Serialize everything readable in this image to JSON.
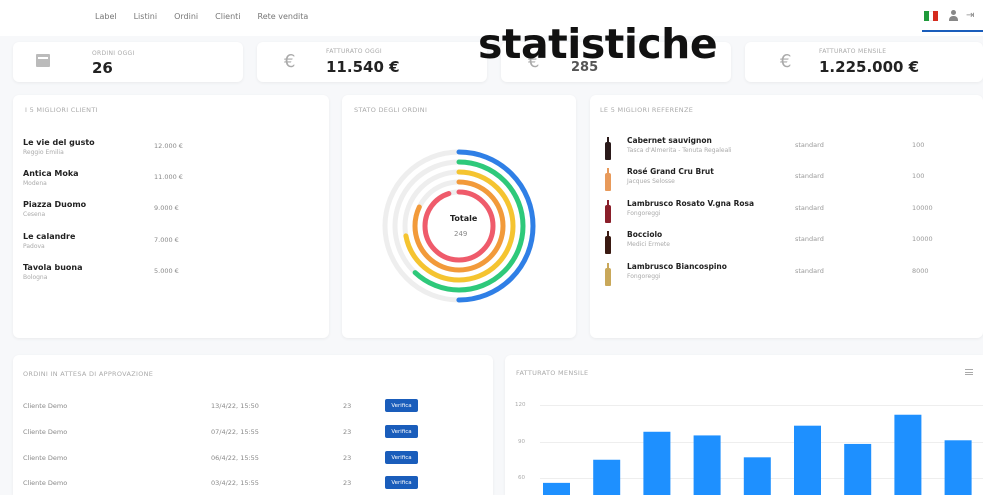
{
  "nav": [
    "Label",
    "Listini",
    "Ordini",
    "Clienti",
    "Rete vendita"
  ],
  "overlay_title": "statistiche",
  "colors": {
    "accent": "#1a5dbb",
    "bar": "#1e90ff",
    "flag": [
      "#1e9a3a",
      "#ffffff",
      "#d52b1e"
    ]
  },
  "kpis": [
    {
      "label": "ORDINI OGGI",
      "value": "26",
      "icon": "box-icon"
    },
    {
      "label": "FATTURATO OGGI",
      "value": "11.540 €",
      "icon": "euro-icon"
    },
    {
      "label": "",
      "value": "285",
      "icon": "euro-icon"
    },
    {
      "label": "FATTURATO MENSILE",
      "value": "1.225.000 €",
      "icon": "euro-icon"
    }
  ],
  "top_clients": {
    "title": "I 5 MIGLIORI CLIENTI",
    "items": [
      {
        "name": "Le vie del gusto",
        "city": "Reggio Emilia",
        "value": "12.000 €"
      },
      {
        "name": "Antica Moka",
        "city": "Modena",
        "value": "11.000 €"
      },
      {
        "name": "Piazza Duomo",
        "city": "Cesena",
        "value": "9.000 €"
      },
      {
        "name": "Le calandre",
        "city": "Padova",
        "value": "7.000 €"
      },
      {
        "name": "Tavola buona",
        "city": "Bologna",
        "value": "5.000 €"
      }
    ]
  },
  "order_status": {
    "title": "STATO DEGLI ORDINI",
    "center_label": "Totale",
    "center_value": "249",
    "rings": [
      {
        "color": "#2f7fe6",
        "fraction": 0.5
      },
      {
        "color": "#2ec97a",
        "fraction": 0.62
      },
      {
        "color": "#f5c430",
        "fraction": 0.72
      },
      {
        "color": "#f29a3a",
        "fraction": 0.82
      },
      {
        "color": "#ef5b6b",
        "fraction": 0.95
      }
    ]
  },
  "top_refs": {
    "title": "LE 5 MIGLIORI REFERENZE",
    "items": [
      {
        "name": "Cabernet sauvignon",
        "producer": "Tasca d'Almerita - Tenuta Regaleali",
        "type": "standard",
        "qty": "100",
        "bottle_color": "#2a1a1a"
      },
      {
        "name": "Rosé Grand Cru Brut",
        "producer": "Jacques Selosse",
        "type": "standard",
        "qty": "100",
        "bottle_color": "#e89a5a"
      },
      {
        "name": "Lambrusco Rosato V.gna Rosa",
        "producer": "Fongoreggi",
        "type": "standard",
        "qty": "10000",
        "bottle_color": "#8a1f2a"
      },
      {
        "name": "Bocciolo",
        "producer": "Medici Ermete",
        "type": "standard",
        "qty": "10000",
        "bottle_color": "#3a1a12"
      },
      {
        "name": "Lambrusco Biancospino",
        "producer": "Fongoreggi",
        "type": "standard",
        "qty": "8000",
        "bottle_color": "#c9a85a"
      }
    ]
  },
  "pending_orders": {
    "title": "ORDINI IN ATTESA DI APPROVAZIONE",
    "rows": [
      {
        "client": "Cliente Demo",
        "date": "13/4/22, 15:50",
        "qty": "23",
        "action": "Verifica"
      },
      {
        "client": "Cliente Demo",
        "date": "07/4/22, 15:55",
        "qty": "23",
        "action": "Verifica"
      },
      {
        "client": "Cliente Demo",
        "date": "06/4/22, 15:55",
        "qty": "23",
        "action": "Verifica"
      },
      {
        "client": "Cliente Demo",
        "date": "03/4/22, 15:55",
        "qty": "23",
        "action": "Verifica"
      }
    ]
  },
  "monthly_revenue": {
    "title": "FATTURATO MENSILE",
    "menu_icon": "hamburger-menu-icon"
  },
  "chart_data": {
    "type": "bar",
    "title": "FATTURATO MENSILE",
    "yticks": [
      "120",
      "90",
      "60"
    ],
    "ylim": [
      0,
      120
    ],
    "values": [
      56,
      75,
      98,
      95,
      77,
      103,
      88,
      112,
      91
    ]
  }
}
